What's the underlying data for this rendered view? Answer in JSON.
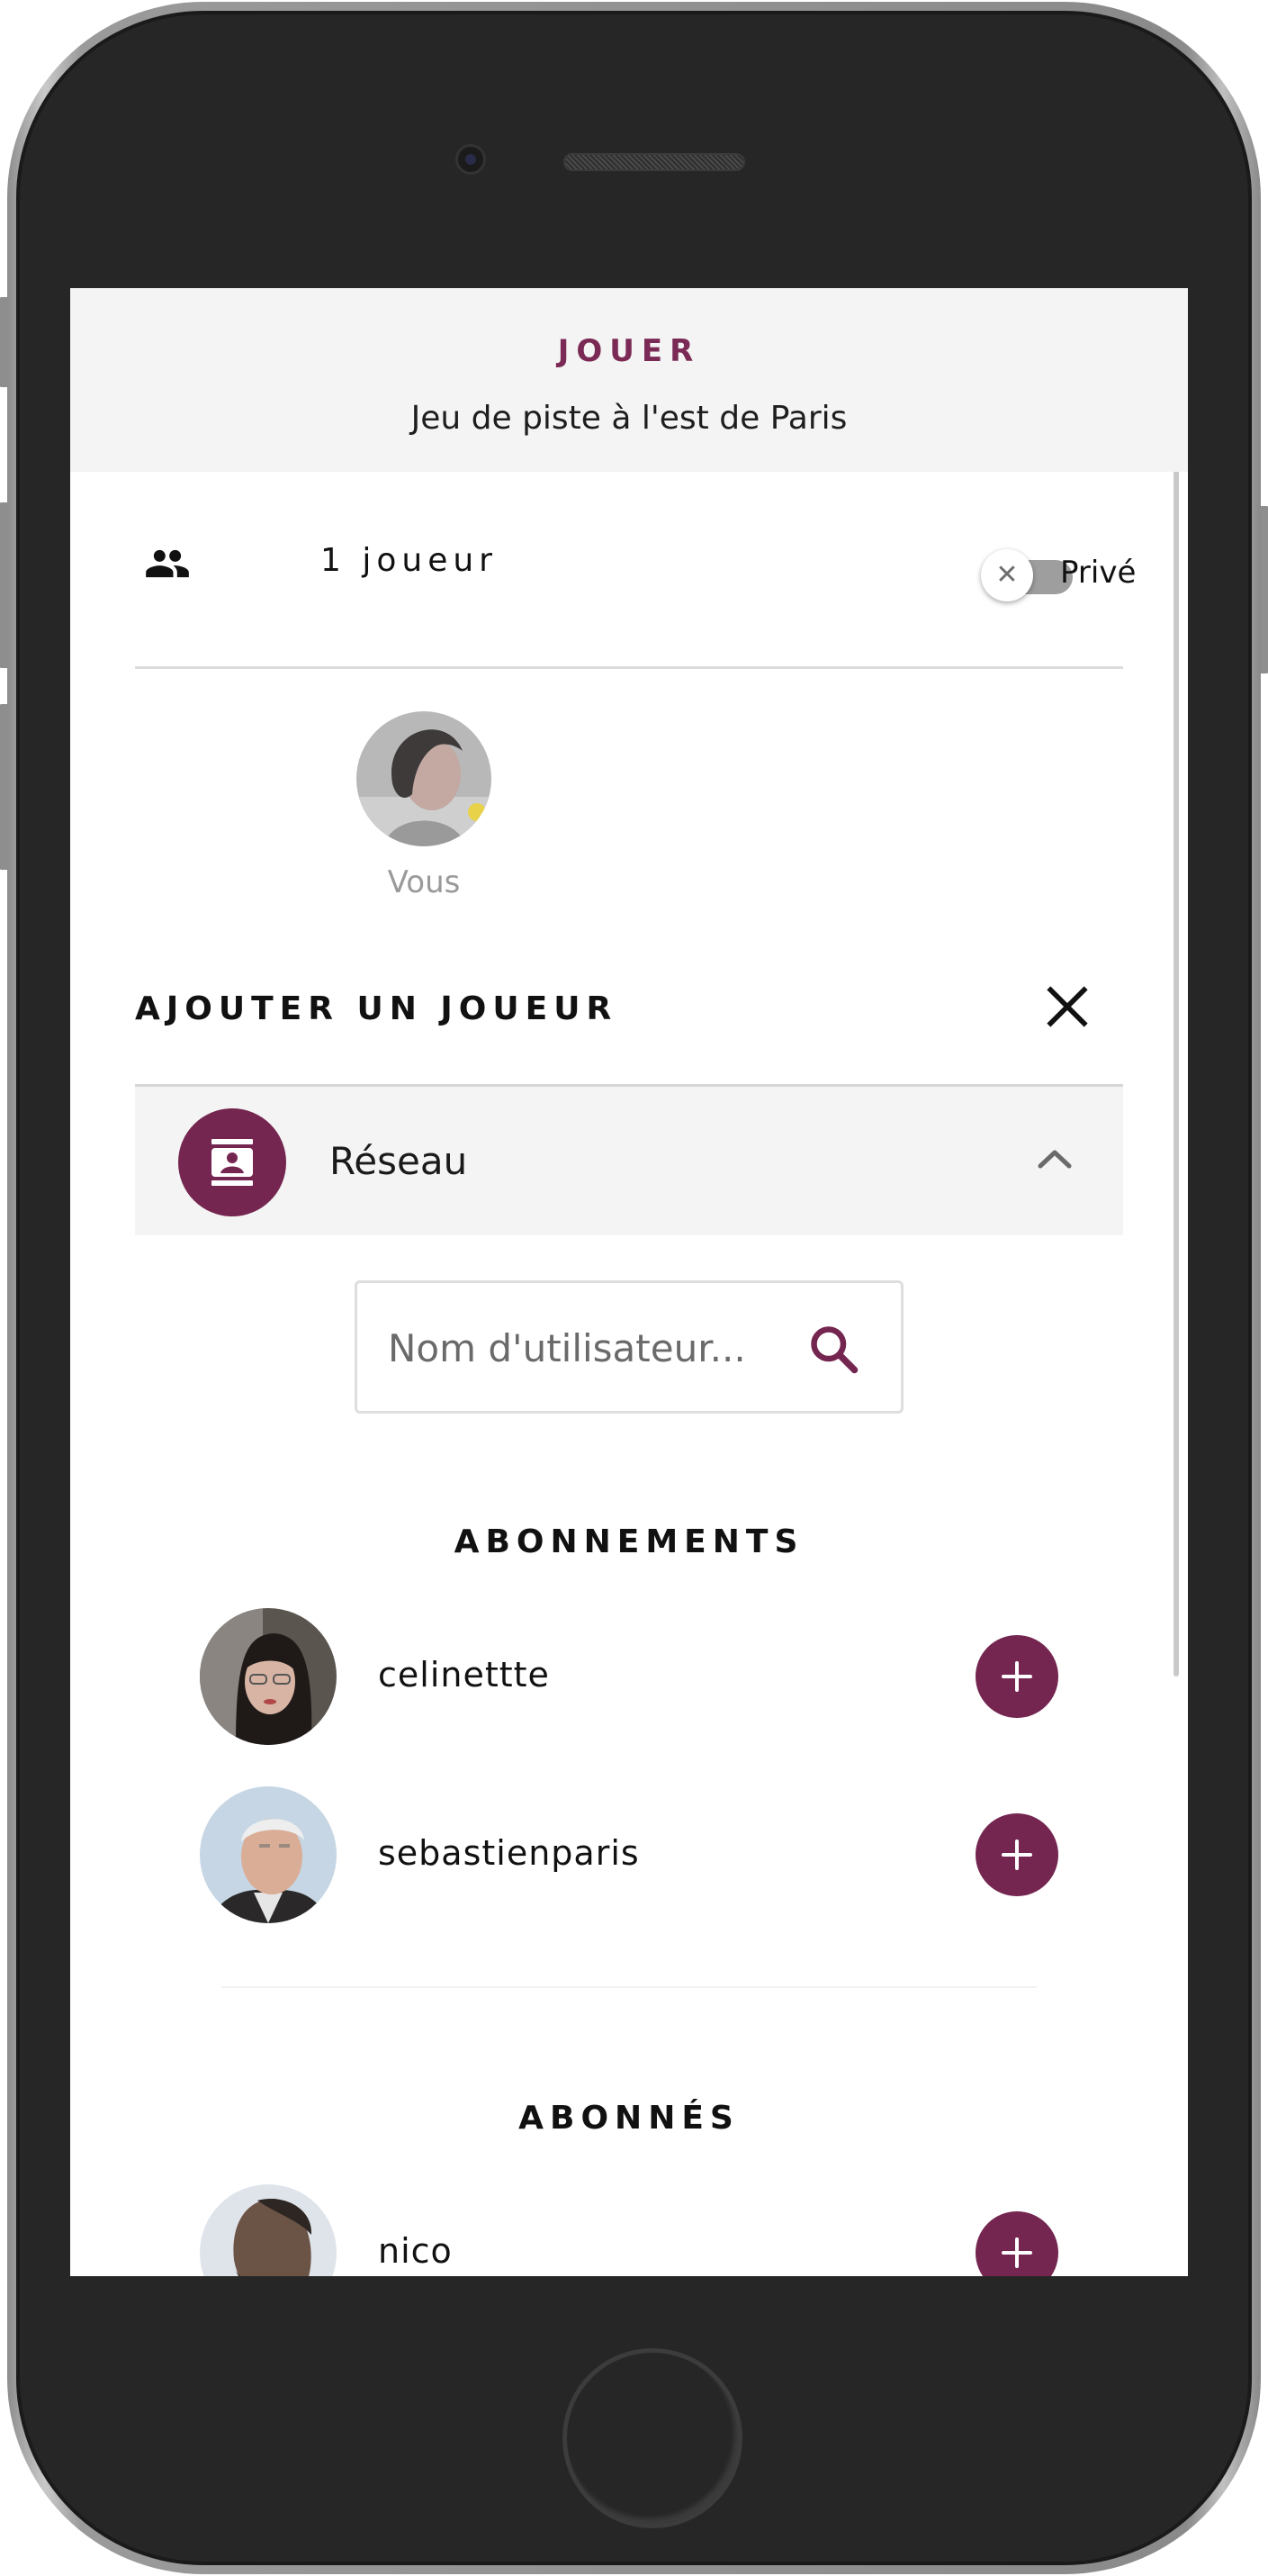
{
  "header": {
    "title": "JOUER",
    "subtitle": "Jeu de piste à l'est de Paris"
  },
  "players": {
    "count_label": "1 joueur",
    "privacy_label": "Privé",
    "private_enabled": false,
    "you_label": "Vous"
  },
  "add_player": {
    "title": "AJOUTER UN JOUEUR",
    "network_label": "Réseau",
    "search_placeholder": "Nom d'utilisateur..."
  },
  "sections": {
    "subscriptions_title": "ABONNEMENTS",
    "subscriptions": [
      {
        "username": "celinettte"
      },
      {
        "username": "sebastienparis"
      }
    ],
    "followers_title": "ABONNÉS",
    "followers": [
      {
        "username": "nico"
      }
    ]
  },
  "colors": {
    "accent": "#742550",
    "title_accent": "#7a2a55",
    "header_bg": "#f4f4f4",
    "toggle_track": "#9e9e9e"
  },
  "icons": {
    "players": "people-icon",
    "toggle_off": "close-small-icon",
    "close": "close-icon",
    "network": "contact-card-icon",
    "collapse": "chevron-up-icon",
    "search": "search-icon",
    "add": "plus-icon"
  }
}
